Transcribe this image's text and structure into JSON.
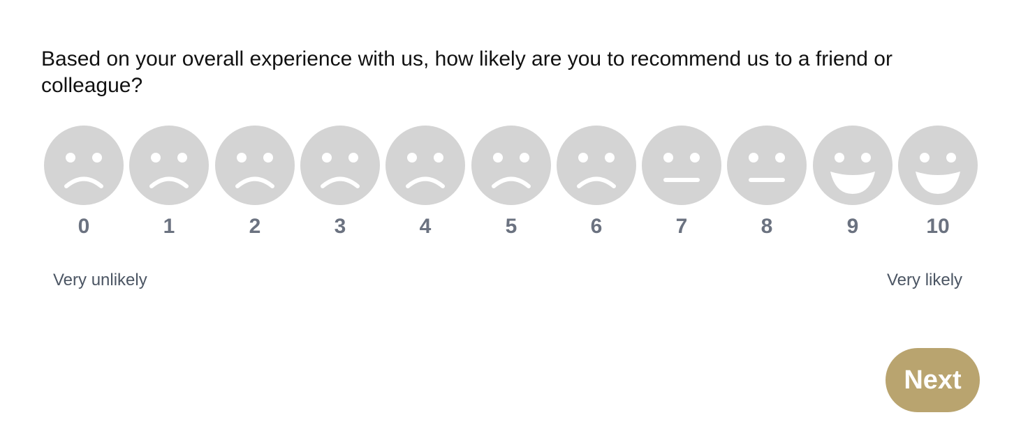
{
  "question": "Based on your overall experience with us, how likely are you to recommend us to a friend or colleague?",
  "scale": {
    "options": [
      {
        "label": "0",
        "face": "sad-face-icon"
      },
      {
        "label": "1",
        "face": "sad-face-icon"
      },
      {
        "label": "2",
        "face": "sad-face-icon"
      },
      {
        "label": "3",
        "face": "sad-face-icon"
      },
      {
        "label": "4",
        "face": "sad-face-icon"
      },
      {
        "label": "5",
        "face": "sad-face-icon"
      },
      {
        "label": "6",
        "face": "sad-face-icon"
      },
      {
        "label": "7",
        "face": "neutral-face-icon"
      },
      {
        "label": "8",
        "face": "neutral-face-icon"
      },
      {
        "label": "9",
        "face": "happy-face-icon"
      },
      {
        "label": "10",
        "face": "happy-face-icon"
      }
    ],
    "low_label": "Very unlikely",
    "high_label": "Very likely"
  },
  "next_button": "Next",
  "colors": {
    "face": "#d4d4d4",
    "face_features": "#ffffff",
    "number": "#6b7280",
    "button": "#b9a46f"
  }
}
